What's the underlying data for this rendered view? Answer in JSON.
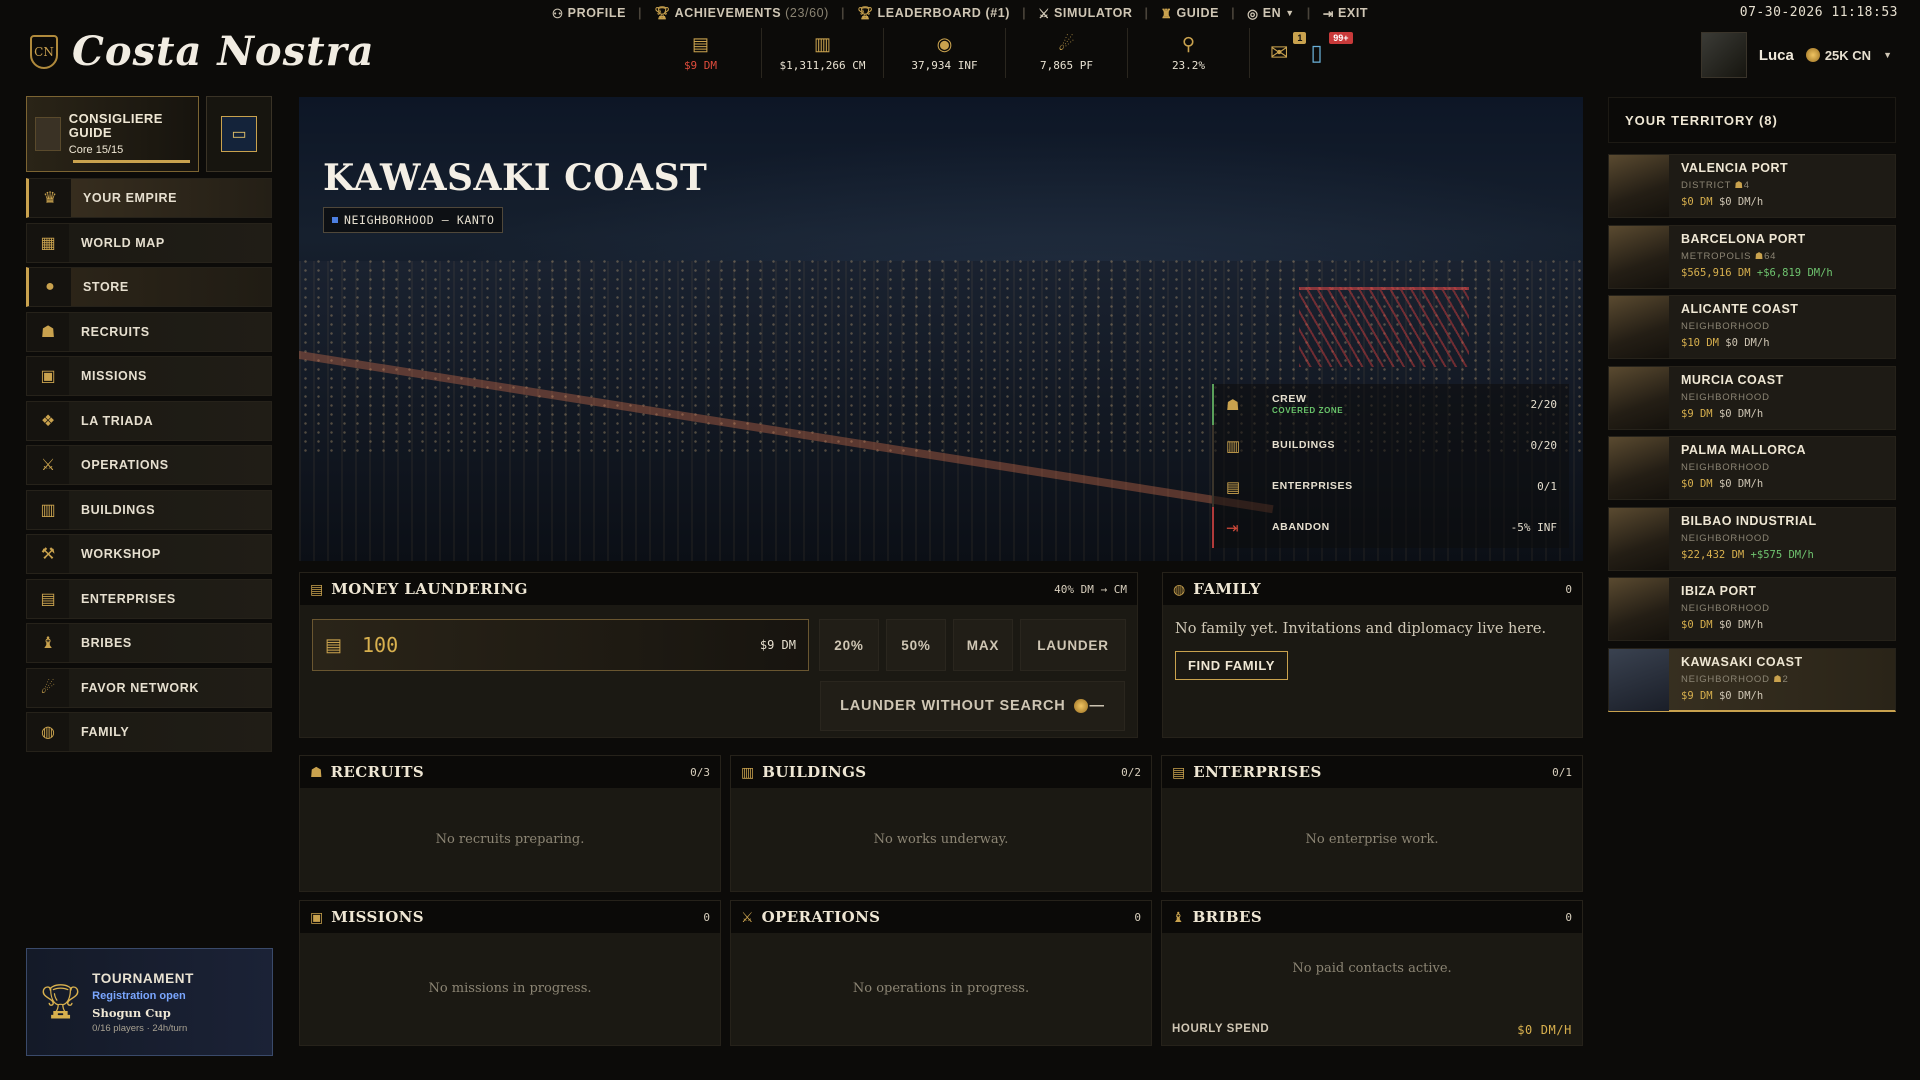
{
  "topnav": {
    "profile": "PROFILE",
    "achievements": "ACHIEVEMENTS",
    "achievements_count": "(23/60)",
    "leaderboard": "LEADERBOARD (#1)",
    "simulator": "SIMULATOR",
    "guide": "GUIDE",
    "language": "EN",
    "exit": "EXIT",
    "clock": "07-30-2026 11:18:53"
  },
  "logo": {
    "emblem": "CN",
    "name": "Costa Nostra"
  },
  "resources": [
    {
      "icon": "cash-stack-icon",
      "value": "$9 DM",
      "warn": true
    },
    {
      "icon": "cash-bundle-icon",
      "value": "$1,311,266 CM"
    },
    {
      "icon": "influence-icon",
      "value": "37,934 INF"
    },
    {
      "icon": "favor-icon",
      "value": "7,865 PF"
    },
    {
      "icon": "magnifier-icon",
      "value": "23.2%"
    }
  ],
  "badges": {
    "mail": "1",
    "phone": "99+"
  },
  "user": {
    "name": "Luca",
    "coins": "25K CN"
  },
  "guide": {
    "title": "CONSIGLIERE GUIDE",
    "core": "Core 15/15"
  },
  "sidebar": {
    "items": [
      {
        "label": "YOUR EMPIRE",
        "icon": "crown-icon"
      },
      {
        "label": "WORLD MAP",
        "icon": "map-icon"
      },
      {
        "label": "STORE",
        "icon": "coin-icon"
      },
      {
        "label": "RECRUITS",
        "icon": "recruits-icon"
      },
      {
        "label": "MISSIONS",
        "icon": "missions-icon"
      },
      {
        "label": "LA TRIADA",
        "icon": "triada-icon"
      },
      {
        "label": "OPERATIONS",
        "icon": "swords-icon"
      },
      {
        "label": "BUILDINGS",
        "icon": "building-icon"
      },
      {
        "label": "WORKSHOP",
        "icon": "workshop-icon"
      },
      {
        "label": "ENTERPRISES",
        "icon": "enterprise-icon"
      },
      {
        "label": "BRIBES",
        "icon": "bribe-icon"
      },
      {
        "label": "FAVOR NETWORK",
        "icon": "favor-icon"
      },
      {
        "label": "FAMILY",
        "icon": "family-icon"
      }
    ]
  },
  "tournament": {
    "title": "TOURNAMENT",
    "status": "Registration open",
    "cup": "Shogun Cup",
    "players": "0/16 players · 24h/turn"
  },
  "hero": {
    "title": "KAWASAKI COAST",
    "tag": "NEIGHBORHOOD — KANTO",
    "stats": [
      {
        "label": "CREW",
        "sub": "COVERED ZONE",
        "value": "2/20",
        "icon": "crew-icon"
      },
      {
        "label": "BUILDINGS",
        "sub": "",
        "value": "0/20",
        "icon": "building-icon"
      },
      {
        "label": "ENTERPRISES",
        "sub": "",
        "value": "0/1",
        "icon": "enterprise-icon"
      },
      {
        "label": "ABANDON",
        "sub": "",
        "value": "-5% INF",
        "icon": "exit-icon"
      }
    ]
  },
  "laundering": {
    "title": "MONEY LAUNDERING",
    "rate": "40% DM → CM",
    "amount": "100",
    "unit": "$9 DM",
    "btn_20": "20%",
    "btn_50": "50%",
    "btn_max": "MAX",
    "btn_launder": "LAUNDER",
    "btn_without": "LAUNDER WITHOUT SEARCH",
    "without_cost": "—"
  },
  "family": {
    "title": "FAMILY",
    "count": "0",
    "text": "No family yet. Invitations and diplomacy live here.",
    "button": "FIND FAMILY"
  },
  "panels": {
    "recruits": {
      "title": "RECRUITS",
      "count": "0/3",
      "empty": "No recruits preparing."
    },
    "buildings": {
      "title": "BUILDINGS",
      "count": "0/2",
      "empty": "No works underway."
    },
    "enterprises": {
      "title": "ENTERPRISES",
      "count": "0/1",
      "empty": "No enterprise work."
    },
    "missions": {
      "title": "MISSIONS",
      "count": "0",
      "empty": "No missions in progress."
    },
    "operations": {
      "title": "OPERATIONS",
      "count": "0",
      "empty": "No operations in progress."
    },
    "bribes": {
      "title": "BRIBES",
      "count": "0",
      "empty": "No paid contacts active.",
      "hourly_label": "HOURLY SPEND",
      "hourly_value": "$0 DM/H"
    }
  },
  "territory": {
    "title": "YOUR TERRITORY (8)",
    "items": [
      {
        "name": "VALENCIA PORT",
        "kind": "DISTRICT",
        "crew": "4",
        "money": "$0 DM",
        "rate": "$0 DM/h",
        "rate_positive": false
      },
      {
        "name": "BARCELONA PORT",
        "kind": "METROPOLIS",
        "crew": "64",
        "money": "$565,916 DM",
        "rate": "+$6,819 DM/h",
        "rate_positive": true
      },
      {
        "name": "ALICANTE COAST",
        "kind": "NEIGHBORHOOD",
        "crew": "",
        "money": "$10 DM",
        "rate": "$0 DM/h",
        "rate_positive": false
      },
      {
        "name": "MURCIA COAST",
        "kind": "NEIGHBORHOOD",
        "crew": "",
        "money": "$9 DM",
        "rate": "$0 DM/h",
        "rate_positive": false
      },
      {
        "name": "PALMA MALLORCA",
        "kind": "NEIGHBORHOOD",
        "crew": "",
        "money": "$0 DM",
        "rate": "$0 DM/h",
        "rate_positive": false
      },
      {
        "name": "BILBAO INDUSTRIAL",
        "kind": "NEIGHBORHOOD",
        "crew": "",
        "money": "$22,432 DM",
        "rate": "+$575 DM/h",
        "rate_positive": true
      },
      {
        "name": "IBIZA PORT",
        "kind": "NEIGHBORHOOD",
        "crew": "",
        "money": "$0 DM",
        "rate": "$0 DM/h",
        "rate_positive": false
      },
      {
        "name": "KAWASAKI COAST",
        "kind": "NEIGHBORHOOD",
        "crew": "2",
        "money": "$9 DM",
        "rate": "$0 DM/h",
        "rate_positive": false,
        "selected": true
      }
    ]
  },
  "colors": {
    "accent": "#c9a24e",
    "danger": "#e04c3c",
    "positive": "#6fc46f",
    "blue": "#7aa6ff"
  }
}
